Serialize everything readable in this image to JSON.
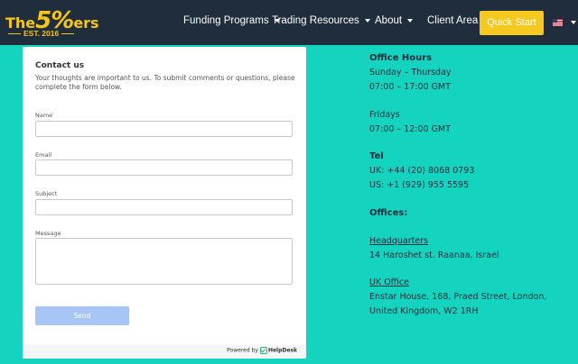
{
  "brand": {
    "logo_text_prefix": "The",
    "logo_text_big": "5%",
    "logo_text_suffix": "ers",
    "logo_est": "EST. 2016"
  },
  "nav": {
    "items": [
      {
        "label": "Funding Programs",
        "has_dropdown": true
      },
      {
        "label": "Trading Resources",
        "has_dropdown": true
      },
      {
        "label": "About",
        "has_dropdown": true
      },
      {
        "label": "Client Area",
        "has_dropdown": false
      }
    ],
    "cta_label": "Quick Start",
    "language_icon": "us-flag-icon"
  },
  "form": {
    "title": "Contact us",
    "description": "Your thoughts are important to us. To submit comments or questions, please complete the form below.",
    "fields": {
      "name_label": "Name",
      "email_label": "Email",
      "subject_label": "Subject",
      "message_label": "Message"
    },
    "send_label": "Send",
    "powered_by": "Powered by",
    "powered_brand": "HelpDesk"
  },
  "info": {
    "office_hours_title": "Office Hours",
    "weekday_days": "Sunday – Thursday",
    "weekday_hours": "07:00 – 17:00 GMT",
    "friday_days": "Fridays",
    "friday_hours": "07:00 – 12:00 GMT",
    "tel_title": "Tel",
    "tel_uk": "UK: +44 (20) 8068 0793",
    "tel_us": "US: +1 (929) 955 5595",
    "offices_title": "Offices:",
    "hq_title": "Headquarters",
    "hq_address": "14 Haroshet st. Raanaa, Israel",
    "uk_title": "UK Office",
    "uk_address_1": "Enstar House, 168, Praed Street, London,",
    "uk_address_2": "United Kingdom, W2 1RH"
  },
  "colors": {
    "background": "#14d3bf",
    "header": "#1f2d3d",
    "accent": "#f7c81f",
    "send_button": "#a8c6f5"
  }
}
